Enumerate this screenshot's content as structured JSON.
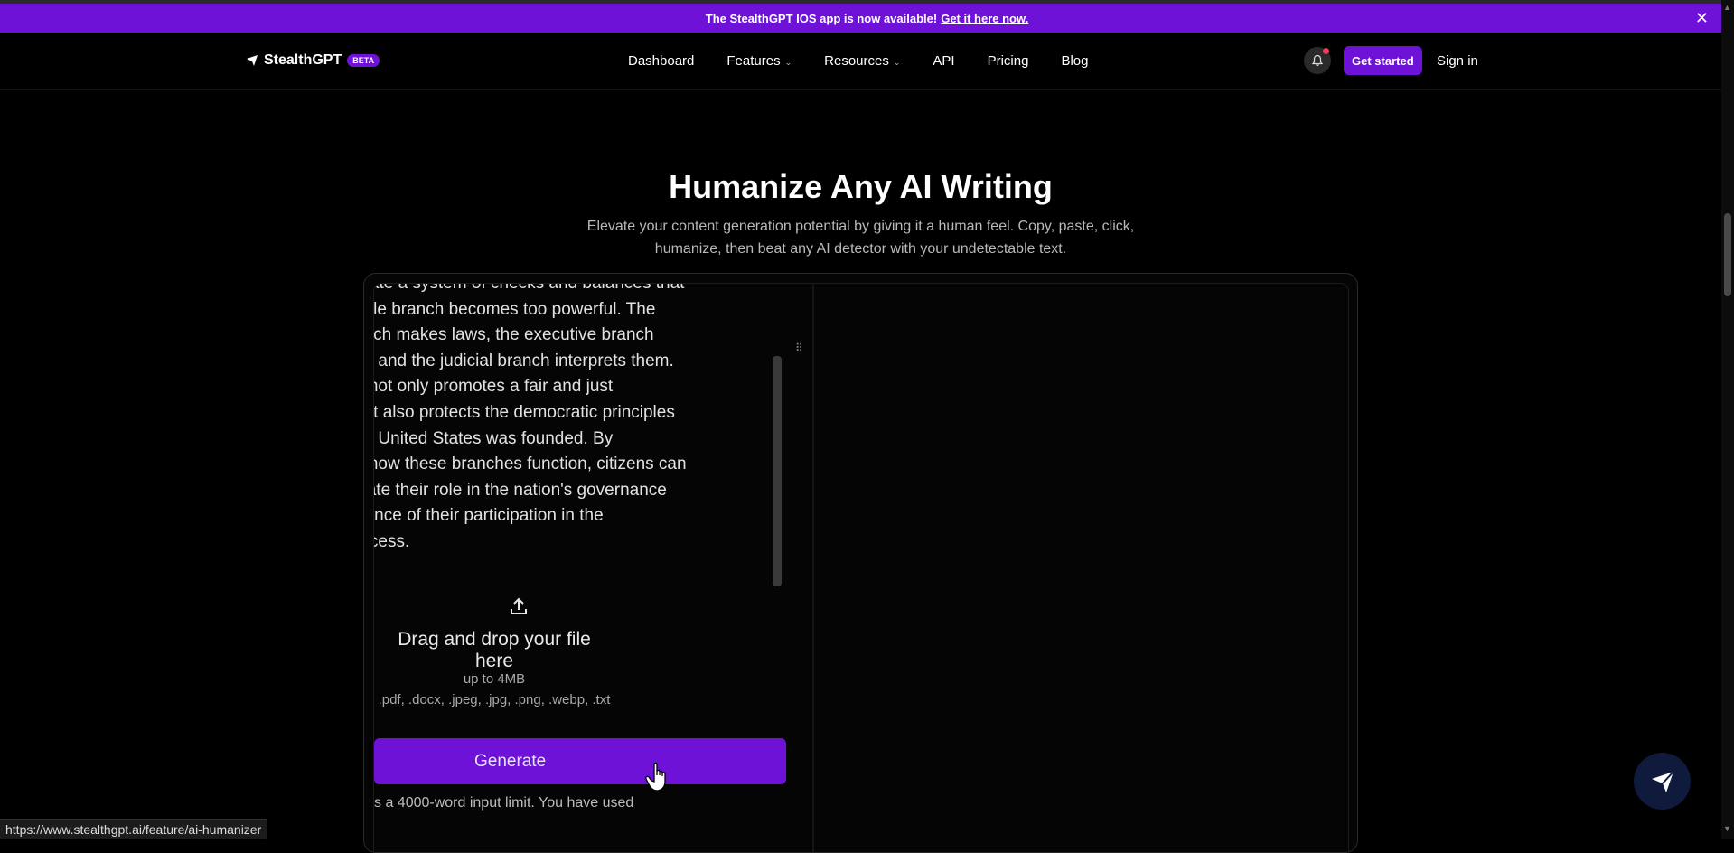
{
  "banner": {
    "message": "The StealthGPT IOS app is now available!",
    "link": "Get it here now."
  },
  "nav": {
    "logo": "StealthGPT",
    "badge": "BETA",
    "items": [
      {
        "label": "Dashboard"
      },
      {
        "label": "Features"
      },
      {
        "label": "Resources"
      },
      {
        "label": "API"
      },
      {
        "label": "Pricing"
      },
      {
        "label": "Blog"
      }
    ],
    "get_started": "Get started",
    "sign_in": "Sign in"
  },
  "hero": {
    "title": "Humanize Any AI Writing",
    "subtitle": "Elevate your content generation potential by giving it a human feel. Copy, paste, click, humanize, then beat any AI detector with your undetectable text."
  },
  "editor": {
    "input_lines": [
      "reate a system of checks and balances that",
      "ngle branch becomes too powerful. The",
      "anch makes laws, the executive branch",
      "m, and the judicial branch interprets them.",
      "e not only promotes a fair and just",
      "out also protects the democratic principles",
      "he United States was founded. By",
      "g how these branches function, citizens can",
      "ciate their role in the nation's governance",
      "rtance of their participation in the",
      "rocess."
    ],
    "drop_label": "Drag and drop your file here",
    "size_limit": "up to 4MB",
    "file_types": ".pdf, .docx, .jpeg, .jpg, .png, .webp, .txt",
    "generate_label": "Generate",
    "limit_text": "s a 4000-word input limit. You have used"
  },
  "status_url": "https://www.stealthgpt.ai/feature/ai-humanizer",
  "colors": {
    "accent": "#6d12d6",
    "background": "#000000"
  }
}
